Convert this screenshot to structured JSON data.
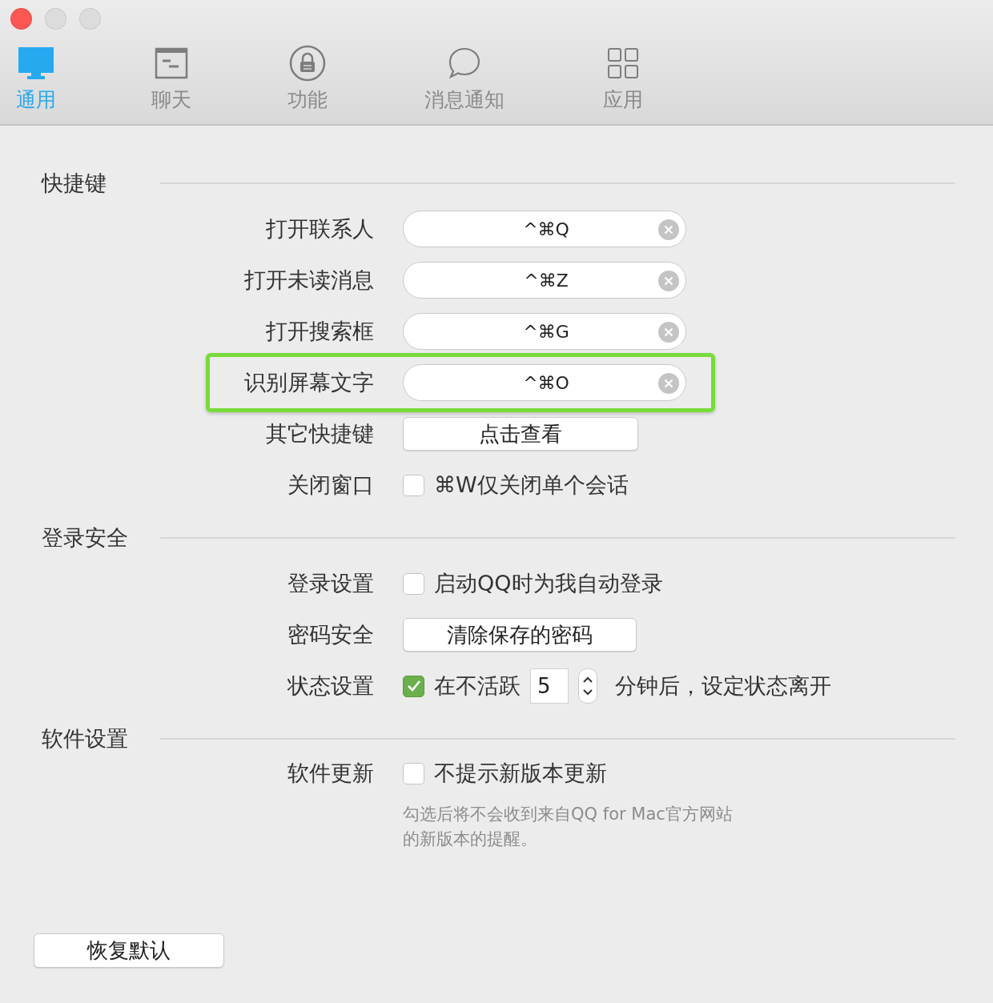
{
  "tabs": [
    {
      "label": "通用",
      "selected": true
    },
    {
      "label": "聊天",
      "selected": false
    },
    {
      "label": "功能",
      "selected": false
    },
    {
      "label": "消息通知",
      "selected": false
    },
    {
      "label": "应用",
      "selected": false
    }
  ],
  "sections": [
    {
      "title": "快捷键",
      "rows": [
        {
          "kind": "shortcut",
          "label": "打开联系人",
          "value": "^⌘Q",
          "highlighted": false
        },
        {
          "kind": "shortcut",
          "label": "打开未读消息",
          "value": "^⌘Z",
          "highlighted": false
        },
        {
          "kind": "shortcut",
          "label": "打开搜索框",
          "value": "^⌘G",
          "highlighted": false
        },
        {
          "kind": "shortcut",
          "label": "识别屏幕文字",
          "value": "^⌘O",
          "highlighted": true
        },
        {
          "kind": "button",
          "label": "其它快捷键",
          "button": "点击查看"
        },
        {
          "kind": "checkbox",
          "label": "关闭窗口",
          "checked": false,
          "text": "⌘W仅关闭单个会话"
        }
      ]
    },
    {
      "title": "登录安全",
      "rows": [
        {
          "kind": "checkbox",
          "label": "登录设置",
          "checked": false,
          "text": "启动QQ时为我自动登录"
        },
        {
          "kind": "button",
          "label": "密码安全",
          "button": "清除保存的密码"
        },
        {
          "kind": "away",
          "label": "状态设置",
          "checked": true,
          "text": "在不活跃",
          "value": "5",
          "text_after": "分钟后，设定状态离开"
        }
      ]
    },
    {
      "title": "软件设置",
      "rows": [
        {
          "kind": "checkbox",
          "label": "软件更新",
          "checked": false,
          "text": "不提示新版本更新",
          "hint_lines": [
            "勾选后将不会收到来自QQ for Mac官方网站",
            "的新版本的提醒。"
          ]
        }
      ]
    }
  ],
  "reset_button": "恢复默认"
}
